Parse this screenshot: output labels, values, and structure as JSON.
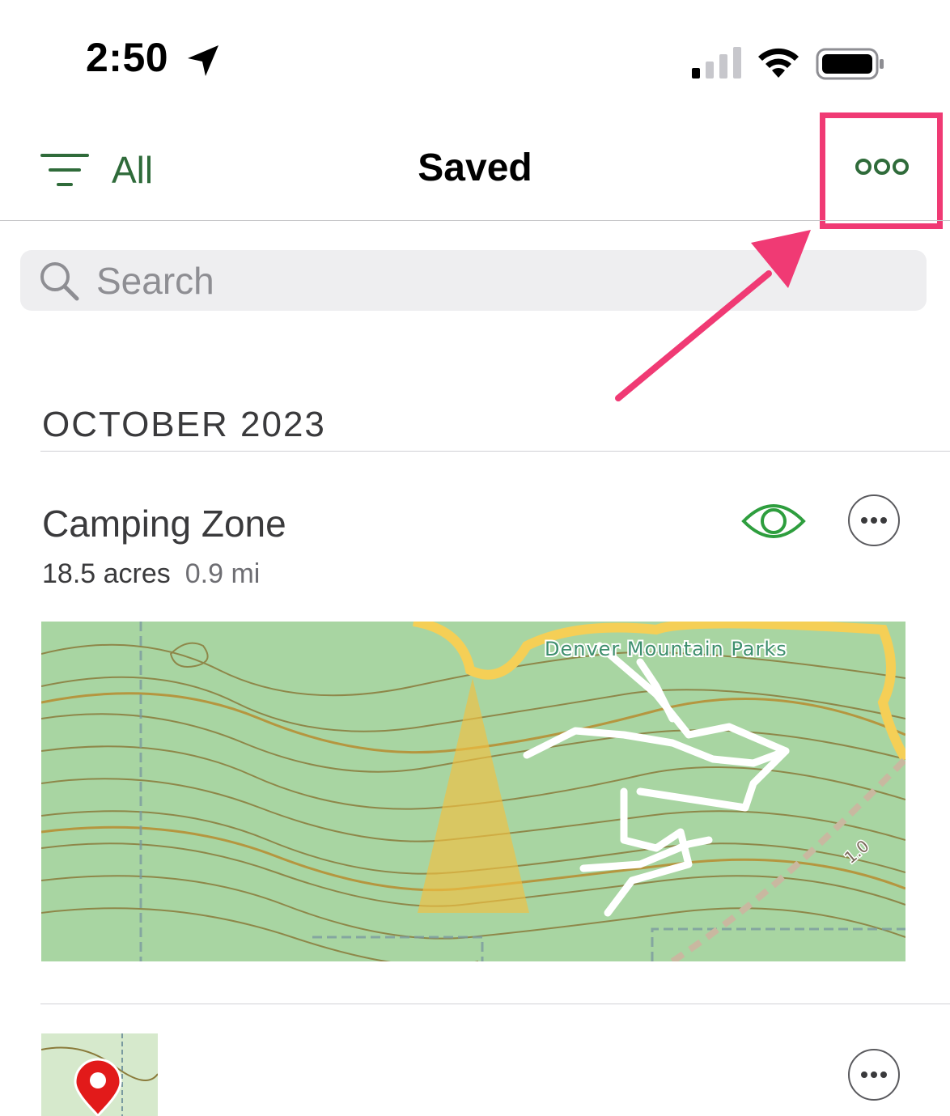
{
  "status_bar": {
    "time": "2:50",
    "icons": [
      "location-arrow-icon",
      "cellular-signal-icon",
      "wifi-icon",
      "battery-icon"
    ]
  },
  "nav": {
    "filter_label": "All",
    "title": "Saved",
    "icons": [
      "filter-lines-icon",
      "more-dots-icon"
    ]
  },
  "search": {
    "placeholder": "Search",
    "value": ""
  },
  "sections": [
    {
      "header": "OCTOBER 2023",
      "items": [
        {
          "title": "Camping Zone",
          "area": "18.5 acres",
          "distance": "0.9 mi",
          "map_label": "Denver Mountain Parks",
          "map_trail_marker": "1.0",
          "visible": true
        },
        {
          "title": "",
          "thumbnail": "map-pin-thumbnail"
        }
      ]
    }
  ],
  "annotation": {
    "highlight_color": "#f03a74",
    "target": "more-options-button"
  },
  "colors": {
    "accent_green": "#2f6b3a",
    "eye_green": "#2e9e3e",
    "map_bg": "#a8d5a2",
    "contour": "#8a7a3a",
    "highlight": "#f03a74"
  }
}
